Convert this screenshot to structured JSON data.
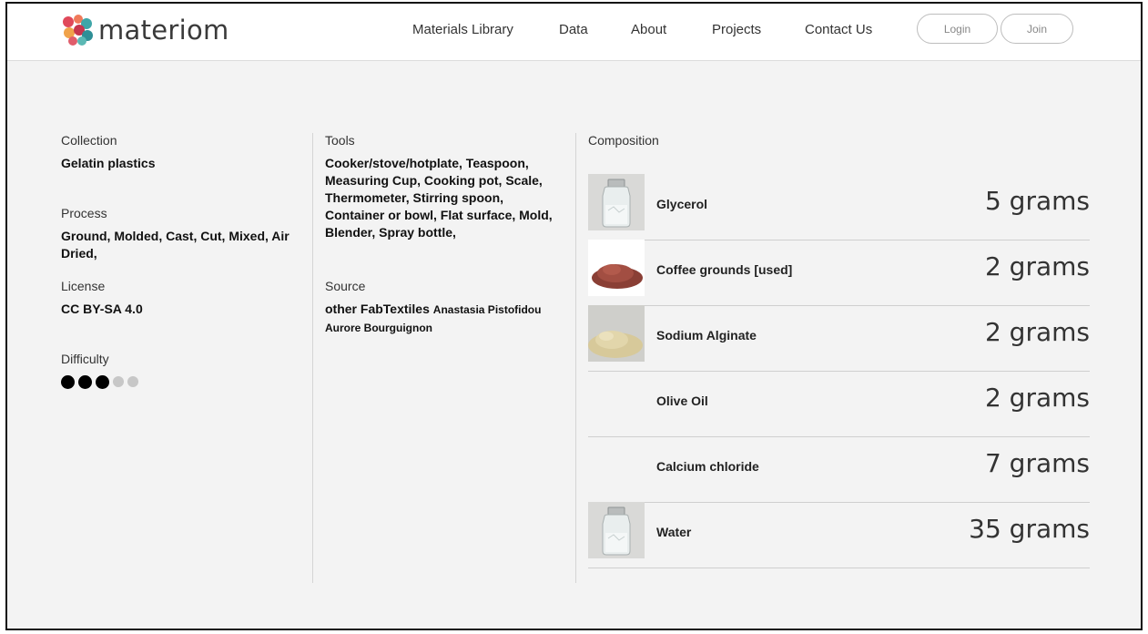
{
  "header": {
    "logo_text": "materiom",
    "nav": [
      "Materials Library",
      "Data",
      "About",
      "Projects",
      "Contact Us"
    ],
    "login_label": "Login",
    "join_label": "Join"
  },
  "details": {
    "collection_label": "Collection",
    "collection_value": "Gelatin plastics",
    "process_label": "Process",
    "process_value": "Ground, Molded, Cast, Cut, Mixed, Air Dried,",
    "license_label": "License",
    "license_value": "CC BY-SA 4.0",
    "difficulty_label": "Difficulty",
    "difficulty_level": 3,
    "difficulty_max": 5
  },
  "tools": {
    "label": "Tools",
    "value": "Cooker/stove/hotplate, Teaspoon, Measuring Cup, Cooking pot, Scale, Thermometer, Stirring spoon, Container or bowl, Flat surface, Mold, Blender, Spray bottle,"
  },
  "source": {
    "label": "Source",
    "primary": "other FabTextiles",
    "authors": "Anastasia Pistofidou Aurore Bourguignon"
  },
  "composition": {
    "label": "Composition",
    "ingredients": [
      {
        "name": "Glycerol",
        "qty": "5 grams",
        "thumb": "jar"
      },
      {
        "name": "Coffee grounds [used]",
        "qty": "2 grams",
        "thumb": "coffee"
      },
      {
        "name": "Sodium Alginate",
        "qty": "2 grams",
        "thumb": "powder"
      },
      {
        "name": "Olive Oil",
        "qty": "2 grams",
        "thumb": "none"
      },
      {
        "name": "Calcium chloride",
        "qty": "7 grams",
        "thumb": "none"
      },
      {
        "name": "Water",
        "qty": "35 grams",
        "thumb": "jar"
      }
    ]
  }
}
